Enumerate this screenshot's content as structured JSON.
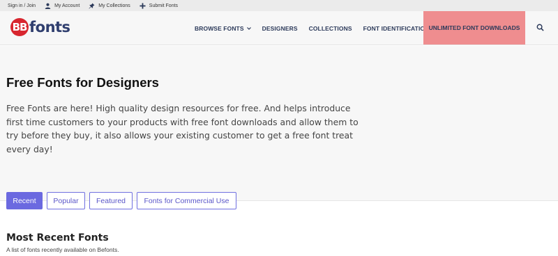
{
  "topbar": {
    "signin": "Sign in / Join",
    "account": "My Account",
    "collections": "My Collections",
    "submit": "Submit Fonts"
  },
  "logo": {
    "mark": "BB",
    "word": "fonts"
  },
  "nav": {
    "browse": "BROWSE FONTS",
    "designers": "DESIGNERS",
    "collections": "COLLECTIONS",
    "identification": "FONT IDENTIFICATION",
    "unlimited": "UNLIMITED FONT DOWNLOADS"
  },
  "hero": {
    "title": "Free Fonts for Designers",
    "description": "Free Fonts are here! High quality design resources for free. And helps introduce first time customers to your products with free font downloads and allow them to try before they buy, it also allows your existing customer to get a free font treat every day!"
  },
  "tabs": [
    {
      "label": "Recent",
      "active": true
    },
    {
      "label": "Popular",
      "active": false
    },
    {
      "label": "Featured",
      "active": false
    },
    {
      "label": "Fonts for Commercial Use",
      "active": false
    }
  ],
  "section": {
    "title": "Most Recent Fonts",
    "subtitle": "A list of fonts recently available on Befonts."
  },
  "colors": {
    "brand_red": "#d8262f",
    "brand_navy": "#2f3e6e",
    "highlight": "#ef8d8f",
    "tab_accent": "#6b69e0"
  }
}
